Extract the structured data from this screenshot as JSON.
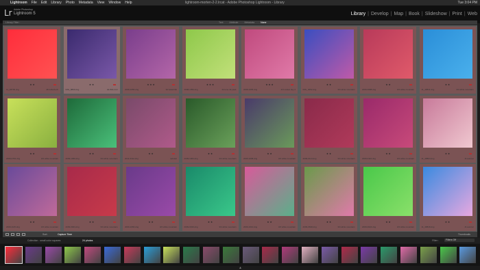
{
  "menubar": {
    "app": "Lightroom",
    "items": [
      "File",
      "Edit",
      "Library",
      "Photo",
      "Metadata",
      "View",
      "Window",
      "Help"
    ],
    "window_title": "lightroom-morten-2-2.lrcat - Adobe Photoshop Lightroom - Library",
    "clock": "Tue 3:04 PM"
  },
  "identity": {
    "logo": "Lr",
    "subtitle": "Adobe Photoshop",
    "product": "Lightroom 5"
  },
  "modules": [
    "Library",
    "Develop",
    "Map",
    "Book",
    "Slideshow",
    "Print",
    "Web"
  ],
  "active_module": "Library",
  "filterbar": {
    "title": "Library Filter :",
    "tabs": [
      "Text",
      "Attribute",
      "Metadata",
      "None"
    ],
    "active_tab": "None"
  },
  "grid": [
    {
      "name": "11_48799.dng",
      "dims": "48 bullet/tech",
      "stars": "★ ★",
      "colors": [
        "#ff2d3b",
        "#ff5252"
      ]
    },
    {
      "name": "IMG_8890.dng",
      "dims": "4d-IMG 4x4",
      "stars": "★ ★",
      "colors": [
        "#3a2a6e",
        "#7a58a8"
      ]
    },
    {
      "name": "2008-1056.dng",
      "dims": "3d bokeh/bit",
      "stars": "★ ★ ★",
      "colors": [
        "#7a3e8c",
        "#b466a8"
      ]
    },
    {
      "name": "2008-1059.dng",
      "dims": "4d tone 4k pack",
      "stars": "★ ★ ★",
      "colors": [
        "#8ec84a",
        "#c2e07a"
      ]
    },
    {
      "name": "2008-1065.dng",
      "dims": "4/3 scales sky 2",
      "stars": "★ ★ ★",
      "colors": [
        "#c04a7e",
        "#e07aa8"
      ]
    },
    {
      "name": "IMG_3052.dng",
      "dims": "3/4 white mountain",
      "stars": "★ ★",
      "colors": [
        "#3a4ec0",
        "#c05aa8"
      ]
    },
    {
      "name": "2009-0088.dng",
      "dims": "3/4 white mountain",
      "stars": "★ ★",
      "colors": [
        "#b83a5a",
        "#e05a6a"
      ]
    },
    {
      "name": "11_48811.dng",
      "dims": "3/4 white mountain",
      "stars": "★ ★",
      "colors": [
        "#2a8ed8",
        "#4ab0ec"
      ]
    },
    {
      "name": "2009-0751.dng",
      "dims": "3/4 white mountain",
      "stars": "★ ★",
      "colors": [
        "#c8e05a",
        "#8ab040"
      ]
    },
    {
      "name": "2009-1060.dng",
      "dims": "3/4 white mountain",
      "stars": "★ ★",
      "colors": [
        "#1e6a3a",
        "#4ac07a"
      ]
    },
    {
      "name": "2011-0112.dng",
      "dims": "nebular",
      "stars": "★ ★",
      "colors": [
        "#7a4a6a",
        "#b05a8a"
      ]
    },
    {
      "name": "2009-1064.dng",
      "dims": "3/4 white mountain",
      "stars": "★ ★",
      "colors": [
        "#2a5a2a",
        "#6aa05a"
      ]
    },
    {
      "name": "2009-1098.dng",
      "dims": "3/4 white mountain",
      "stars": "★ ★",
      "colors": [
        "#4a3a6a",
        "#6a9a5a"
      ]
    },
    {
      "name": "2009-0114.dng",
      "dims": "3/4 white mountain",
      "stars": "★ ★",
      "colors": [
        "#8a2a4a",
        "#b03a5a"
      ]
    },
    {
      "name": "2009-0116.dng",
      "dims": "3/4 white mountain",
      "stars": "★ ★",
      "colors": [
        "#9a2a6a",
        "#c84a7a"
      ]
    },
    {
      "name": "11_48804.dng",
      "dims": "4f-auroral",
      "stars": "★ ★",
      "colors": [
        "#c87a9a",
        "#f0c8d0"
      ]
    },
    {
      "name": "2009-1115.dng",
      "dims": "3/4 white mountain",
      "stars": "★ ★",
      "colors": [
        "#6a4a9a",
        "#c06a9a"
      ]
    },
    {
      "name": "2009-0004.dng",
      "dims": "3/4 white mountain",
      "stars": "★ ★",
      "colors": [
        "#a82a4a",
        "#c83a4a"
      ]
    },
    {
      "name": "2009-1066.dng",
      "dims": "3/4 white mountain",
      "stars": "★ ★",
      "colors": [
        "#6a3a8a",
        "#9a4aa8"
      ]
    },
    {
      "name": "2009-0016.dng",
      "dims": "3/4 white mountain",
      "stars": "★ ★",
      "colors": [
        "#1a8a6a",
        "#3ac88a"
      ]
    },
    {
      "name": "2009-1010.dng",
      "dims": "3/4 white mountain",
      "stars": "★ ★",
      "colors": [
        "#d85a9a",
        "#5ab08a"
      ]
    },
    {
      "name": "2009-0818.dng",
      "dims": "3/4 white mountain",
      "stars": "★ ★",
      "colors": [
        "#6a9a4a",
        "#e07aaa"
      ]
    },
    {
      "name": "2009-0024.dng",
      "dims": "3/4 white mountain",
      "stars": "★ ★",
      "colors": [
        "#4ac84a",
        "#8ae06a"
      ]
    },
    {
      "name": "11_48818.dng",
      "dims": "4f-auroral",
      "stars": "★ ★",
      "colors": [
        "#3a8ae0",
        "#e8a8e0"
      ]
    }
  ],
  "toolbar": {
    "sort_label": "Sort:",
    "sort_value": "Capture Time",
    "thumbs_label": "Thumbnails"
  },
  "filmstrip_header": {
    "collection": "Collection : small color squares",
    "count": "24 photos",
    "filter_label": "Filter :",
    "filter_value": "Filters Off"
  },
  "filmstrip": [
    "#ff2d3b",
    "#6a3a8a",
    "#9a4aa8",
    "#8ec84a",
    "#c04a7e",
    "#3a6ad8",
    "#c83a5a",
    "#2a9ed8",
    "#c8e05a",
    "#2a7a4a",
    "#8a4a6a",
    "#3a7a3a",
    "#6a5a7a",
    "#a82a4a",
    "#b03a7a",
    "#e0b0c0",
    "#7a5aa8",
    "#b02a4a",
    "#7a3aa8",
    "#2a9a6a",
    "#e06aa8",
    "#7aa04a",
    "#4ac84a",
    "#5a9ae0"
  ]
}
